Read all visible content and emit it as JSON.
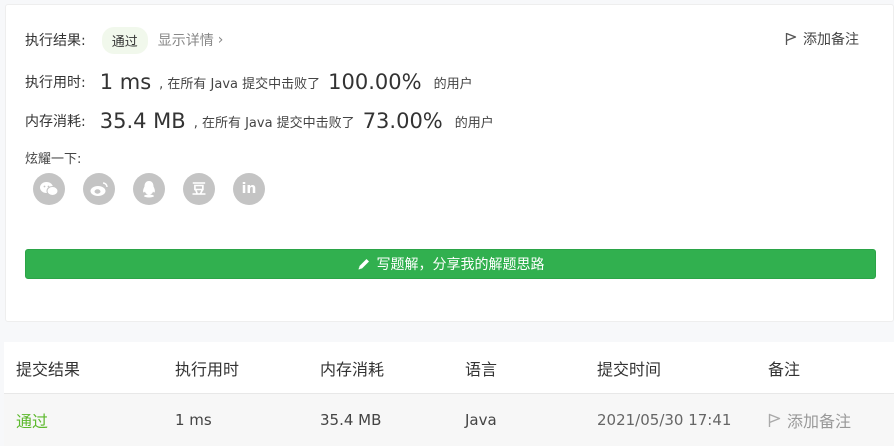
{
  "result": {
    "label": "执行结果:",
    "status": "通过",
    "details_link": "显示详情",
    "details_chevron": "›",
    "note_button": "添加备注"
  },
  "runtime": {
    "label": "执行用时:",
    "value": "1 ms",
    "beat_text": ", 在所有 Java 提交中击败了",
    "percent": "100.00%",
    "users_text": "的用户"
  },
  "memory": {
    "label": "内存消耗:",
    "value": "35.4 MB",
    "beat_text": ", 在所有 Java 提交中击败了",
    "percent": "73.00%",
    "users_text": "的用户"
  },
  "share": {
    "label": "炫耀一下:",
    "icons": [
      {
        "name": "wechat-icon",
        "glyph": ""
      },
      {
        "name": "weibo-icon",
        "glyph": ""
      },
      {
        "name": "qq-icon",
        "glyph": ""
      },
      {
        "name": "douban-icon",
        "glyph": "豆"
      },
      {
        "name": "linkedin-icon",
        "glyph": "in"
      }
    ]
  },
  "write_solution_button": "写题解，分享我的解题思路",
  "table": {
    "headers": [
      "提交结果",
      "执行用时",
      "内存消耗",
      "语言",
      "提交时间",
      "备注"
    ],
    "row": {
      "status": "通过",
      "runtime": "1 ms",
      "memory": "35.4 MB",
      "language": "Java",
      "time": "2021/05/30 17:41",
      "note": "添加备注"
    }
  },
  "colors": {
    "accent_green": "#31b04f",
    "pass_green": "#5cb82c",
    "icon_gray": "#c4c4c4"
  }
}
